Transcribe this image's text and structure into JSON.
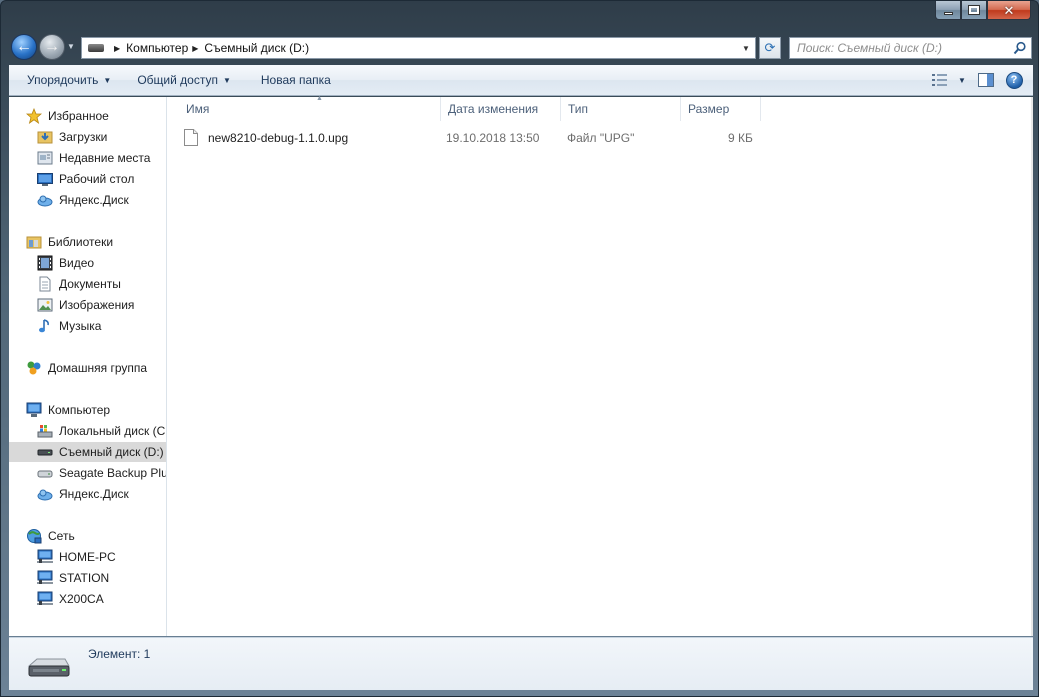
{
  "address": {
    "crumbs": [
      "Компьютер",
      "Съемный диск (D:)"
    ]
  },
  "search": {
    "placeholder": "Поиск: Съемный диск (D:)"
  },
  "toolbar": {
    "organize_label": "Упорядочить",
    "share_label": "Общий доступ",
    "new_folder_label": "Новая папка"
  },
  "sidebar": {
    "favorites": {
      "label": "Избранное",
      "items": [
        "Загрузки",
        "Недавние места",
        "Рабочий стол",
        "Яндекс.Диск"
      ]
    },
    "libraries": {
      "label": "Библиотеки",
      "items": [
        "Видео",
        "Документы",
        "Изображения",
        "Музыка"
      ]
    },
    "homegroup": {
      "label": "Домашняя группа"
    },
    "computer": {
      "label": "Компьютер",
      "items": [
        "Локальный диск (C",
        "Съемный диск (D:)",
        "Seagate Backup Plus",
        "Яндекс.Диск"
      ],
      "selected_index": 1
    },
    "network": {
      "label": "Сеть",
      "items": [
        "HOME-PC",
        "STATION",
        "X200CA"
      ]
    }
  },
  "columns": {
    "name": "Имя",
    "date": "Дата изменения",
    "type": "Тип",
    "size": "Размер"
  },
  "files": [
    {
      "name": "new8210-debug-1.1.0.upg",
      "date": "19.10.2018 13:50",
      "type": "Файл \"UPG\"",
      "size": "9 КБ"
    }
  ],
  "details": {
    "count_text": "Элемент: 1"
  },
  "colors": {
    "selected_bg": "#d9d9d9",
    "link_text": "#1e395b"
  }
}
